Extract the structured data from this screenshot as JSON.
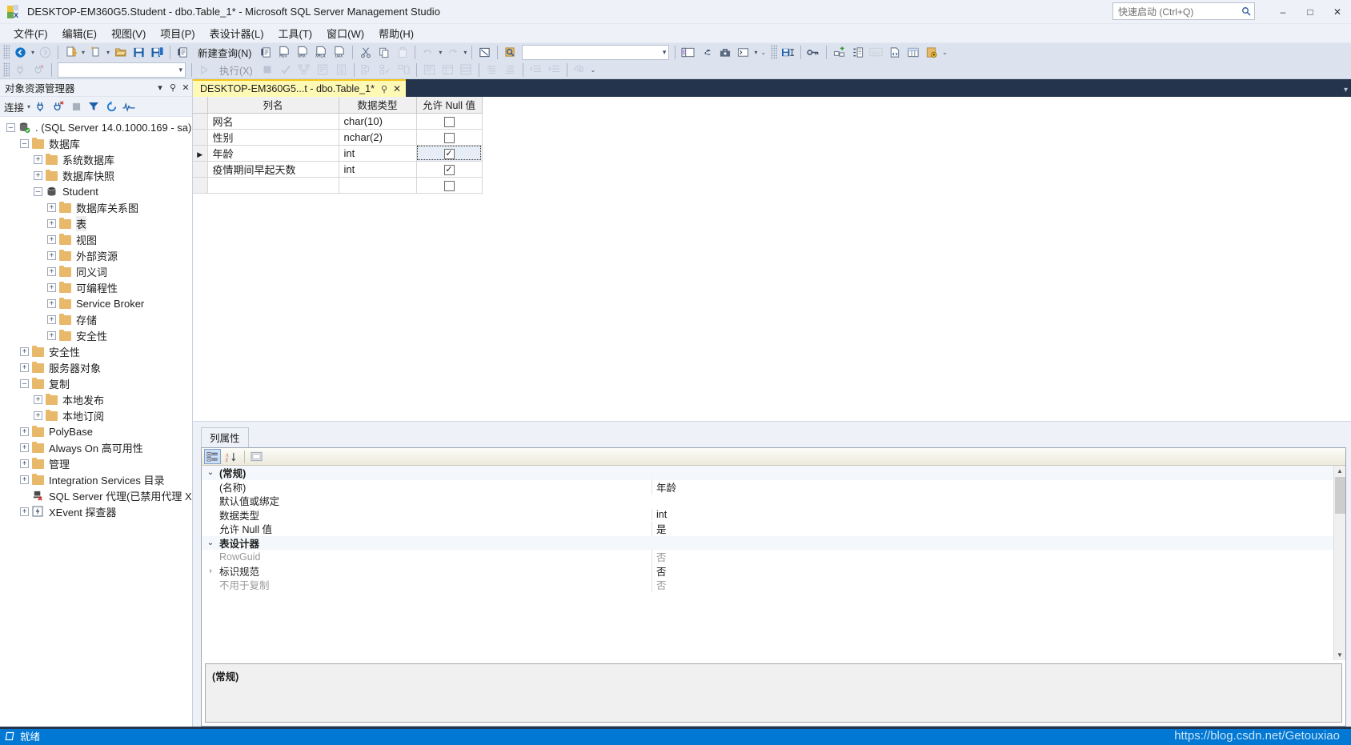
{
  "window": {
    "title": "DESKTOP-EM360G5.Student - dbo.Table_1* - Microsoft SQL Server Management Studio",
    "minimize_label": "–",
    "maximize_label": "□",
    "close_label": "✕"
  },
  "quick_launch": {
    "placeholder": "快速启动 (Ctrl+Q)",
    "value": "快速启动 (Ctrl+Q)",
    "icon": "search-icon"
  },
  "menu": {
    "items": [
      {
        "label": "文件(F)"
      },
      {
        "label": "编辑(E)"
      },
      {
        "label": "视图(V)"
      },
      {
        "label": "项目(P)"
      },
      {
        "label": "表设计器(L)"
      },
      {
        "label": "工具(T)"
      },
      {
        "label": "窗口(W)"
      },
      {
        "label": "帮助(H)"
      }
    ]
  },
  "toolbar": {
    "new_query_label": "新建查询(N)",
    "execute_label": "执行(X)",
    "mdx_label": "MDX",
    "dmx_label": "DMX",
    "xmla_label": "XMLA",
    "dax_label": "DAX",
    "database_combo_value": "",
    "search_combo_value": ""
  },
  "object_explorer": {
    "title": "对象资源管理器",
    "connect_label": "连接",
    "tree": [
      {
        "label": ". (SQL Server 14.0.1000.169 - sa)",
        "depth": 0,
        "state": "minus",
        "icon": "server-icon"
      },
      {
        "label": "数据库",
        "depth": 1,
        "state": "minus",
        "icon": "folder-icon"
      },
      {
        "label": "系统数据库",
        "depth": 2,
        "state": "plus",
        "icon": "folder-icon"
      },
      {
        "label": "数据库快照",
        "depth": 2,
        "state": "plus",
        "icon": "folder-icon"
      },
      {
        "label": "Student",
        "depth": 2,
        "state": "minus",
        "icon": "database-icon"
      },
      {
        "label": "数据库关系图",
        "depth": 3,
        "state": "plus",
        "icon": "folder-icon"
      },
      {
        "label": "表",
        "depth": 3,
        "state": "plus",
        "icon": "folder-icon",
        "selected": true
      },
      {
        "label": "视图",
        "depth": 3,
        "state": "plus",
        "icon": "folder-icon"
      },
      {
        "label": "外部资源",
        "depth": 3,
        "state": "plus",
        "icon": "folder-icon"
      },
      {
        "label": "同义词",
        "depth": 3,
        "state": "plus",
        "icon": "folder-icon"
      },
      {
        "label": "可编程性",
        "depth": 3,
        "state": "plus",
        "icon": "folder-icon"
      },
      {
        "label": "Service Broker",
        "depth": 3,
        "state": "plus",
        "icon": "folder-icon"
      },
      {
        "label": "存储",
        "depth": 3,
        "state": "plus",
        "icon": "folder-icon"
      },
      {
        "label": "安全性",
        "depth": 3,
        "state": "plus",
        "icon": "folder-icon"
      },
      {
        "label": "安全性",
        "depth": 1,
        "state": "plus",
        "icon": "folder-icon"
      },
      {
        "label": "服务器对象",
        "depth": 1,
        "state": "plus",
        "icon": "folder-icon"
      },
      {
        "label": "复制",
        "depth": 1,
        "state": "minus",
        "icon": "folder-icon"
      },
      {
        "label": "本地发布",
        "depth": 2,
        "state": "plus",
        "icon": "folder-icon"
      },
      {
        "label": "本地订阅",
        "depth": 2,
        "state": "plus",
        "icon": "folder-icon"
      },
      {
        "label": "PolyBase",
        "depth": 1,
        "state": "plus",
        "icon": "folder-icon"
      },
      {
        "label": "Always On 高可用性",
        "depth": 1,
        "state": "plus",
        "icon": "folder-icon"
      },
      {
        "label": "管理",
        "depth": 1,
        "state": "plus",
        "icon": "folder-icon"
      },
      {
        "label": "Integration Services 目录",
        "depth": 1,
        "state": "plus",
        "icon": "folder-icon"
      },
      {
        "label": "SQL Server 代理(已禁用代理 XP)",
        "depth": 1,
        "state": "none",
        "icon": "agent-disabled-icon"
      },
      {
        "label": "XEvent 探查器",
        "depth": 1,
        "state": "plus",
        "icon": "xevent-icon"
      }
    ]
  },
  "document_tab": {
    "label": "DESKTOP-EM360G5...t - dbo.Table_1*",
    "pin_label": "⚐",
    "close_label": "✕"
  },
  "designer": {
    "headers": [
      "列名",
      "数据类型",
      "允许 Null 值"
    ],
    "rows": [
      {
        "marker": "",
        "name": "网名",
        "type": "char(10)",
        "allow_null": false,
        "active": false
      },
      {
        "marker": "",
        "name": "性别",
        "type": "nchar(2)",
        "allow_null": false,
        "active": false
      },
      {
        "marker": "▶",
        "name": "年龄",
        "type": "int",
        "allow_null": true,
        "active": true
      },
      {
        "marker": "",
        "name": "疫情期间早起天数",
        "type": "int",
        "allow_null": true,
        "active": false
      },
      {
        "marker": "",
        "name": "",
        "type": "",
        "allow_null": false,
        "active": false
      }
    ],
    "checked_glyph": "✓"
  },
  "column_properties": {
    "tab_label": "列属性",
    "toolbar": {
      "categorized_icon": "categorized-view-icon",
      "alphabetical_icon": "alphabetical-sort-icon",
      "pages_icon": "property-pages-icon"
    },
    "rows": [
      {
        "kind": "category",
        "twisty": "⌄",
        "name": "(常规)",
        "value": ""
      },
      {
        "kind": "prop",
        "twisty": "",
        "name": "(名称)",
        "value": "年龄"
      },
      {
        "kind": "prop",
        "twisty": "",
        "name": "默认值或绑定",
        "value": ""
      },
      {
        "kind": "prop",
        "twisty": "",
        "name": "数据类型",
        "value": "int"
      },
      {
        "kind": "prop",
        "twisty": "",
        "name": "允许 Null 值",
        "value": "是"
      },
      {
        "kind": "category",
        "twisty": "⌄",
        "name": "表设计器",
        "value": ""
      },
      {
        "kind": "prop-dim",
        "twisty": "",
        "name": "RowGuid",
        "value": "否"
      },
      {
        "kind": "prop",
        "twisty": "›",
        "name": "标识规范",
        "value": "否"
      },
      {
        "kind": "prop-dim",
        "twisty": "",
        "name": "不用于复制",
        "value": "否"
      }
    ],
    "description_title": "(常规)",
    "scroll_up": "▲",
    "scroll_down": "▼"
  },
  "status_bar": {
    "icon": "ready-icon",
    "text": "就绪",
    "watermark": "https://blog.csdn.net/Getouxiao"
  },
  "colors": {
    "accent": "#0078d4",
    "tab_active": "#fff9b6",
    "tab_accent": "#f5c518",
    "chrome": "#eef1f7",
    "tabstrip_dark": "#24344d",
    "folder": "#e8b96a"
  }
}
